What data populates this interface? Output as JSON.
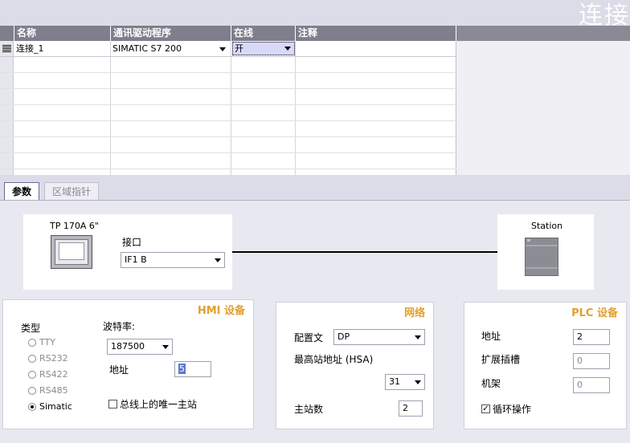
{
  "window": {
    "title": "连接"
  },
  "table": {
    "columns": [
      "名称",
      "通讯驱动程序",
      "在线",
      "注释"
    ],
    "rows": [
      {
        "name": "连接_1",
        "driver": "SIMATIC S7 200",
        "online": "开",
        "comment": ""
      }
    ]
  },
  "tabs": [
    {
      "label": "参数",
      "active": true
    },
    {
      "label": "区域指针",
      "active": false
    }
  ],
  "topology": {
    "hmi_device_label": "TP 170A 6\"",
    "interface_label": "接口",
    "interface_value": "IF1 B",
    "station_label": "Station"
  },
  "hmi_group": {
    "title": "HMI 设备",
    "type_label": "类型",
    "type_options": [
      {
        "label": "TTY",
        "selected": false
      },
      {
        "label": "RS232",
        "selected": false
      },
      {
        "label": "RS422",
        "selected": false
      },
      {
        "label": "RS485",
        "selected": false
      },
      {
        "label": "Simatic",
        "selected": true
      }
    ],
    "baud_label": "波特率:",
    "baud_value": "187500",
    "address_label": "地址",
    "address_value": "5",
    "single_master_label": "总线上的唯一主站",
    "single_master_checked": false
  },
  "network_group": {
    "title": "网络",
    "profile_label": "配置文",
    "profile_value": "DP",
    "hsa_label": "最高站地址 (HSA)",
    "hsa_value": "31",
    "masters_label": "主站数",
    "masters_value": "2"
  },
  "plc_group": {
    "title": "PLC 设备",
    "address_label": "地址",
    "address_value": "2",
    "slot_label": "扩展插槽",
    "slot_value": "0",
    "rack_label": "机架",
    "rack_value": "0",
    "cyclic_label": "循环操作",
    "cyclic_checked": true
  },
  "colors": {
    "header_bg": "#7e7e8c",
    "group_title": "#e0a030",
    "selection": "#d8d8f8",
    "window_bg": "#dcdce8"
  }
}
